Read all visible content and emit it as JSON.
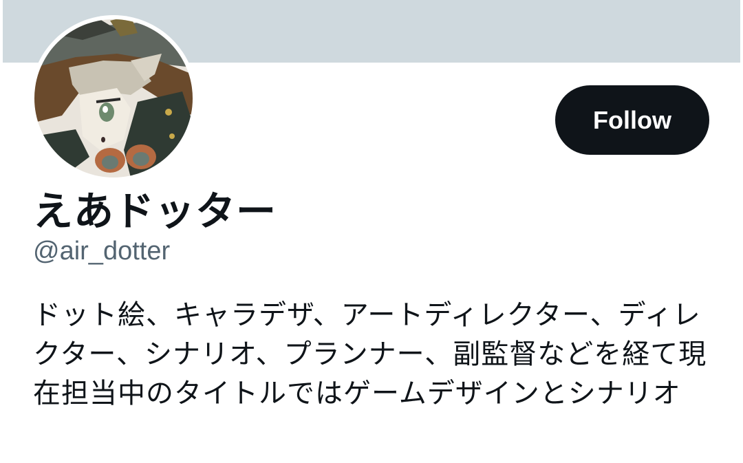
{
  "profile": {
    "display_name": "えあドッター",
    "handle": "@air_dotter",
    "bio": "ドット絵、キャラデザ、アートディレクター、ディレクター、シナリオ、プランナー、副監督などを経て現在担当中のタイトルではゲームデザインとシナリオ",
    "avatar_icon": "pixel-art-character-avatar"
  },
  "actions": {
    "follow_label": "Follow"
  },
  "colors": {
    "banner": "#cfd9de",
    "text_primary": "#0f1419",
    "text_secondary": "#536471",
    "button_bg": "#0f1419",
    "button_text": "#ffffff"
  }
}
